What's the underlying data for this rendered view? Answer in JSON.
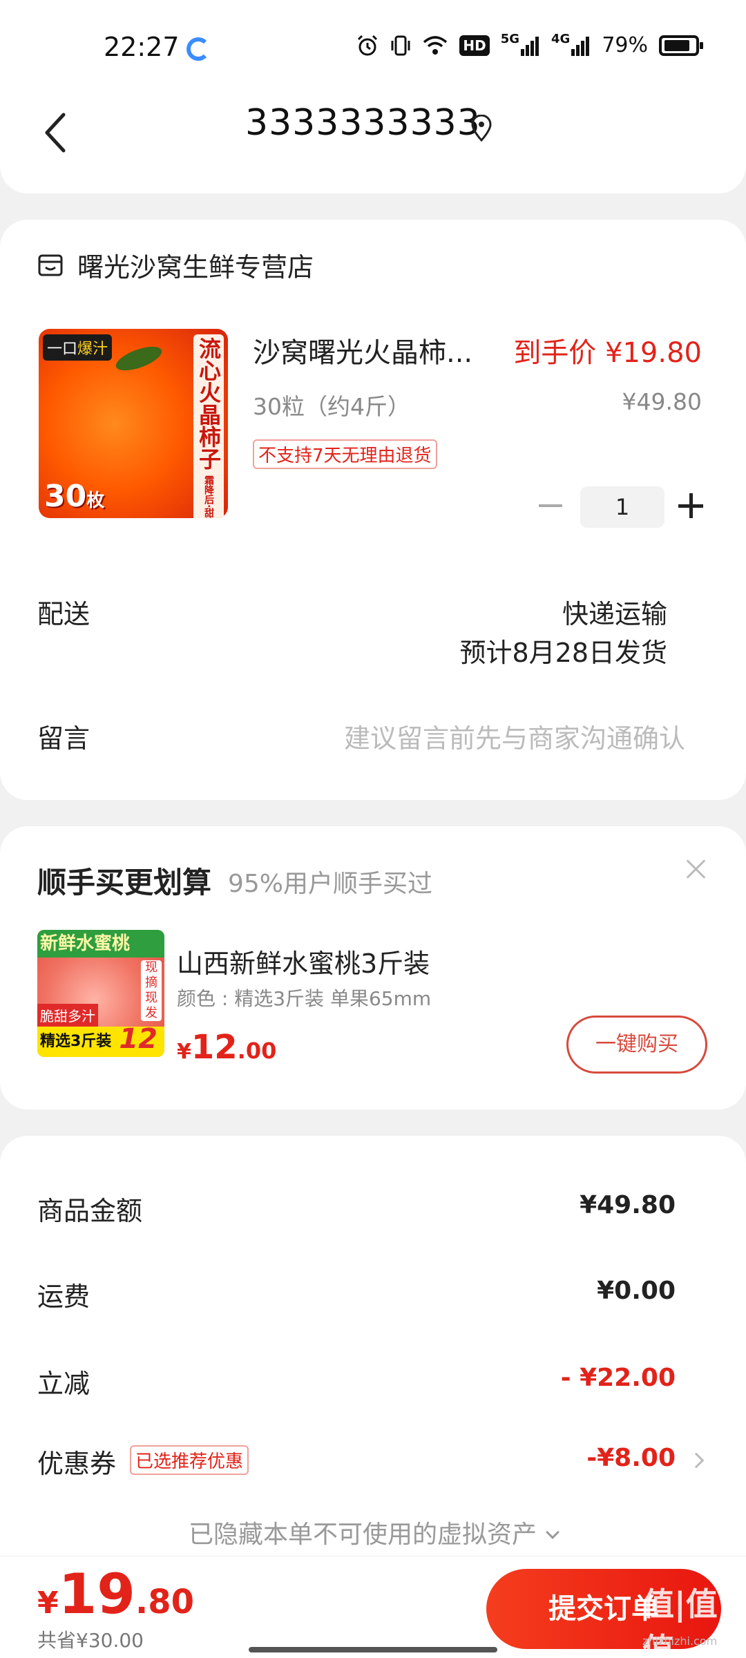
{
  "status_bar": {
    "time": "22:27",
    "hd": "HD",
    "net1": "5G",
    "net2": "4G",
    "battery": "79%"
  },
  "header": {
    "title": "3333333333"
  },
  "shop": {
    "name": "曙光沙窝生鲜专营店"
  },
  "product": {
    "image_top_tag_prefix": "一口",
    "image_top_tag_highlight": "爆汁",
    "image_vertical_text": "流心火晶柿子",
    "image_vertical_small": "霜降后·甜柿子",
    "image_count": "30",
    "image_count_unit": "枚",
    "title": "沙窝曙光火晶柿...",
    "price": "到手价 ¥19.80",
    "spec": "30粒（约4斤）",
    "original_price": "¥49.80",
    "tag": "不支持7天无理由退货",
    "quantity": "1"
  },
  "delivery": {
    "label": "配送",
    "method": "快递运输",
    "date": "预计8月28日发货"
  },
  "note": {
    "label": "留言",
    "placeholder": "建议留言前先与商家沟通确认"
  },
  "addon": {
    "title": "顺手买更划算",
    "subtitle": "95%用户顺手买过",
    "img_top": "新鲜水蜜桃",
    "img_side": "现摘现发",
    "img_badge1": "脆甜多汁",
    "img_badge2": "精选3斤装",
    "img_badge2_num": "12",
    "name": "山西新鲜水蜜桃3斤装",
    "spec": "颜色 : 精选3斤装 单果65mm",
    "price_symbol": "¥",
    "price_int": "12",
    "price_dec": ".00",
    "button": "一键购买"
  },
  "summary": {
    "items": [
      {
        "label": "商品金额",
        "value": "¥49.80"
      },
      {
        "label": "运费",
        "value": "¥0.00"
      },
      {
        "label": "立减",
        "value": "- ¥22.00"
      },
      {
        "label": "优惠券",
        "value": "-¥8.00"
      }
    ],
    "coupon_tag": "已选推荐优惠",
    "hidden_note": "已隐藏本单不可使用的虚拟资产"
  },
  "footer": {
    "price_symbol": "¥",
    "price_int": "19",
    "price_dec": ".80",
    "saved": "共省¥30.00",
    "submit": "提交订单",
    "watermark": "值|值|值",
    "watermark_sub": "zhizhizhi.com"
  },
  "colors": {
    "accent": "#e2231a",
    "background": "#f1f1f1"
  }
}
